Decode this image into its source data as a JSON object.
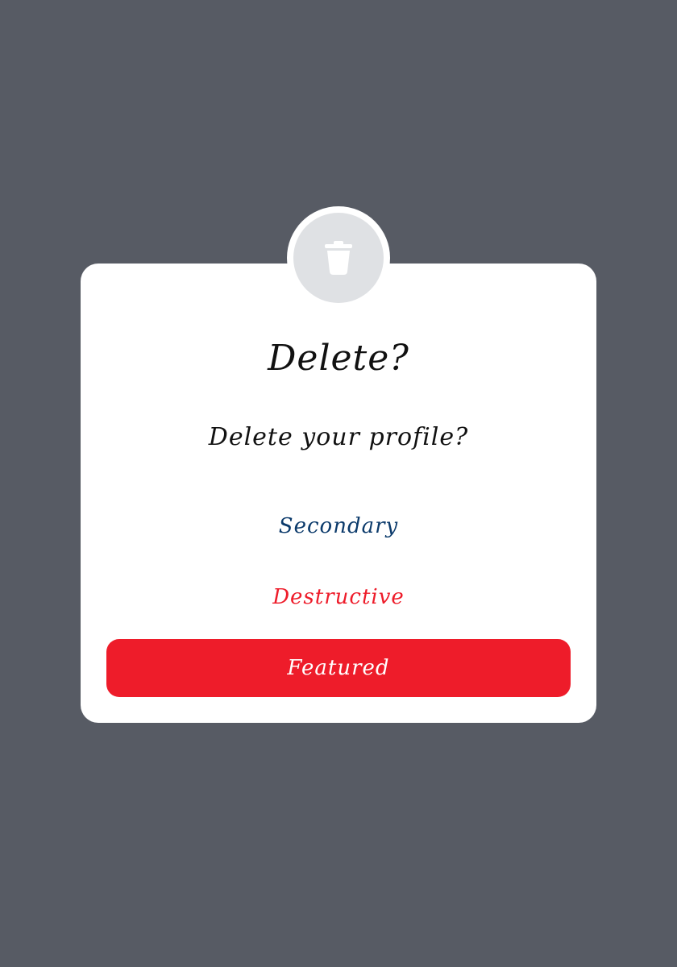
{
  "dialog": {
    "icon": "trash-icon",
    "title": "Delete?",
    "message": "Delete your profile?",
    "buttons": {
      "secondary_label": "Secondary",
      "destructive_label": "Destructive",
      "featured_label": "Featured"
    }
  },
  "colors": {
    "backdrop": "#575b64",
    "surface": "#ffffff",
    "icon_circle": "#dfe1e4",
    "secondary_text": "#0b3a6b",
    "destructive": "#ee1c2a"
  }
}
